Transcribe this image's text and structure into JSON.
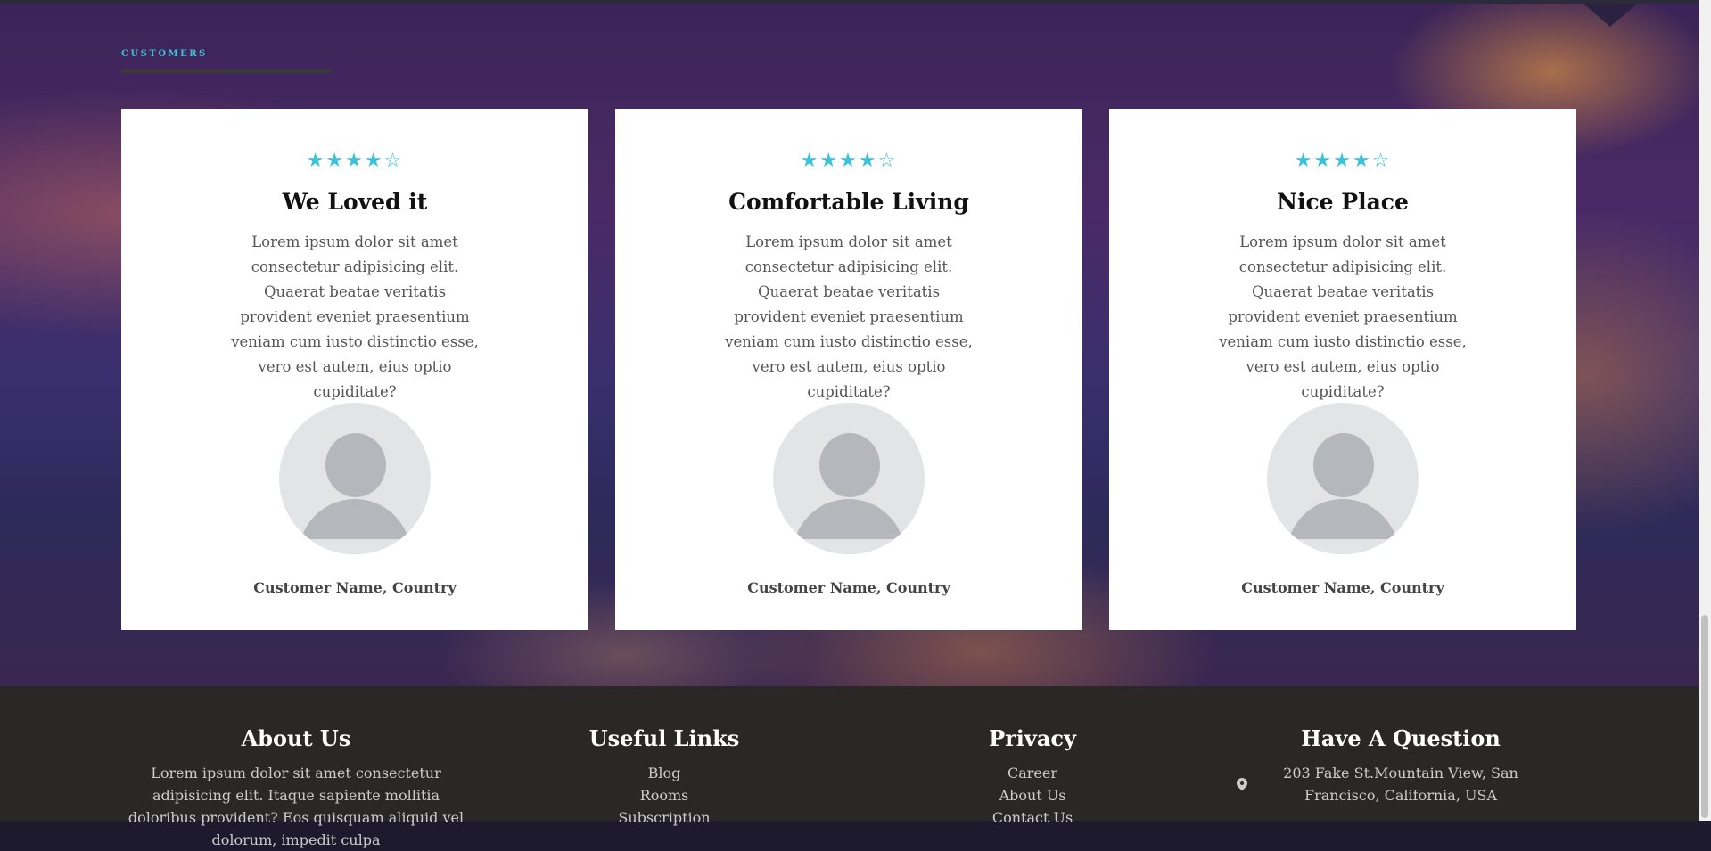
{
  "section": {
    "label": "CUSTOMERS"
  },
  "testimonials": [
    {
      "stars": "★★★★☆",
      "rating": 4,
      "title": "We Loved it",
      "text": "Lorem ipsum dolor sit amet consectetur adipisicing elit. Quaerat beatae veritatis provident eveniet praesentium veniam cum iusto distinctio esse, vero est autem, eius optio cupiditate?",
      "customer": "Customer Name, Country"
    },
    {
      "stars": "★★★★☆",
      "rating": 4,
      "title": "Comfortable Living",
      "text": "Lorem ipsum dolor sit amet consectetur adipisicing elit. Quaerat beatae veritatis provident eveniet praesentium veniam cum iusto distinctio esse, vero est autem, eius optio cupiditate?",
      "customer": "Customer Name, Country"
    },
    {
      "stars": "★★★★☆",
      "rating": 4,
      "title": "Nice Place",
      "text": "Lorem ipsum dolor sit amet consectetur adipisicing elit. Quaerat beatae veritatis provident eveniet praesentium veniam cum iusto distinctio esse, vero est autem, eius optio cupiditate?",
      "customer": "Customer Name, Country"
    }
  ],
  "footer": {
    "about": {
      "title": "About Us",
      "text": "Lorem ipsum dolor sit amet consectetur adipisicing elit. Itaque sapiente mollitia doloribus provident? Eos quisquam aliquid vel dolorum, impedit culpa"
    },
    "useful_links": {
      "title": "Useful Links",
      "links": [
        "Blog",
        "Rooms",
        "Subscription"
      ]
    },
    "privacy": {
      "title": "Privacy",
      "links": [
        "Career",
        "About Us",
        "Contact Us"
      ]
    },
    "question": {
      "title": "Have A Question",
      "address": "203 Fake St.Mountain View, San Francisco, California, USA"
    }
  },
  "colors": {
    "accent": "#3cc2d8",
    "footer_bg": "#2a2827"
  }
}
